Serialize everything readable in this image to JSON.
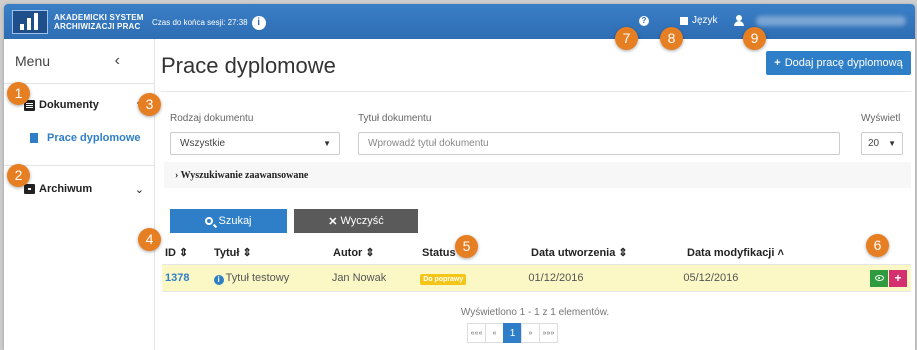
{
  "app": {
    "logo_line1": "AKADEMICKI SYSTEM",
    "logo_line2": "ARCHIWIZACJI PRAC",
    "session_label": "Czas do końca sesji: 27:38",
    "language_label": "Język"
  },
  "sidebar": {
    "menu_title": "Menu",
    "collapse_glyph": "‹",
    "sections": [
      {
        "label": "Dokumenty",
        "chevron": "⌃",
        "icon": "document-icon"
      },
      {
        "label": "Archiwum",
        "chevron": "⌄",
        "icon": "archive-icon"
      }
    ],
    "sub_item": "Prace dyplomowe"
  },
  "main": {
    "title": "Prace dyplomowe",
    "add_button": "Dodaj pracę dyplomową",
    "filters": {
      "type_label": "Rodzaj dokumentu",
      "type_value": "Wszystkie",
      "title_label": "Tytuł dokumentu",
      "title_placeholder": "Wprowadź tytuł dokumentu",
      "show_label": "Wyświetl",
      "show_value": "20"
    },
    "advanced_search": "› Wyszukiwanie zaawansowane",
    "search_button": "Szukaj",
    "clear_button": "Wyczyść"
  },
  "table": {
    "headers": [
      "ID ⇕",
      "Tytuł ⇕",
      "Autor ⇕",
      "Status",
      "Data utworzenia ⇕",
      "Data modyfikacji ˄"
    ],
    "rows": [
      {
        "id": "1378",
        "title": "Tytuł testowy",
        "author": "Jan Nowak",
        "status": "Do poprawy",
        "created": "01/12/2016",
        "modified": "05/12/2016"
      }
    ]
  },
  "pagination": {
    "summary": "Wyświetlono 1 - 1 z 1 elementów.",
    "first": "«««",
    "prev": "«",
    "current": "1",
    "next": "»",
    "last": "»»»"
  },
  "markers": [
    "1",
    "2",
    "3",
    "4",
    "5",
    "6",
    "7",
    "8",
    "9"
  ],
  "colors": {
    "topbar": "#2e6db4",
    "primary": "#2f7fc8",
    "marker": "#e67e22",
    "highlight_row": "#fbf8c6",
    "status_badge": "#f5c518",
    "view_action": "#2e9b3e",
    "add_action": "#d4306f"
  }
}
